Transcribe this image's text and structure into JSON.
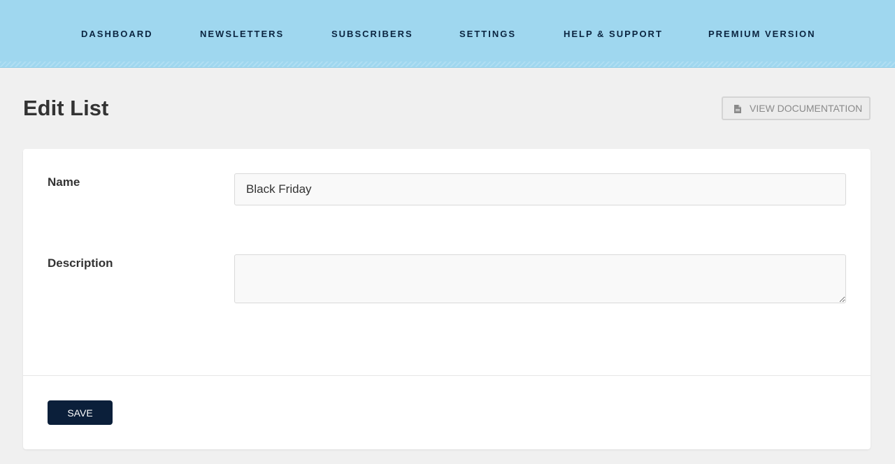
{
  "nav": {
    "items": [
      {
        "label": "DASHBOARD"
      },
      {
        "label": "NEWSLETTERS"
      },
      {
        "label": "SUBSCRIBERS"
      },
      {
        "label": "SETTINGS"
      },
      {
        "label": "HELP & SUPPORT"
      },
      {
        "label": "PREMIUM VERSION"
      }
    ]
  },
  "header": {
    "title": "Edit List",
    "doc_button": {
      "label": "VIEW DOCUMENTATION",
      "icon": "document-icon"
    }
  },
  "form": {
    "name": {
      "label": "Name",
      "value": "Black Friday"
    },
    "description": {
      "label": "Description",
      "value": ""
    },
    "save_label": "SAVE"
  },
  "colors": {
    "nav_background": "#9fd7ef",
    "nav_text": "#0b2540",
    "save_button": "#0b1f3a",
    "page_background": "#f0f0f0"
  }
}
